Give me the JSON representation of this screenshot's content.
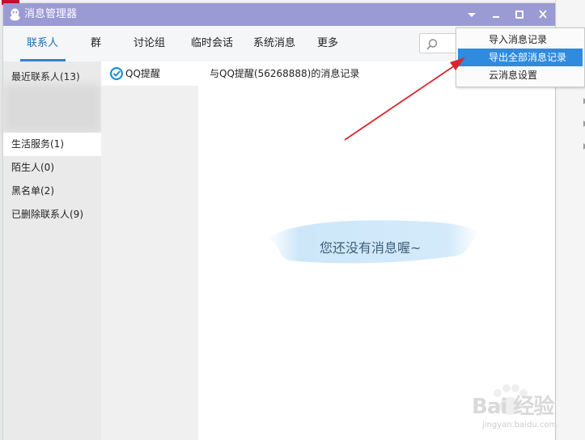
{
  "window": {
    "title": "消息管理器"
  },
  "tabs": [
    {
      "label": "联系人",
      "active": true
    },
    {
      "label": "群",
      "active": false
    },
    {
      "label": "讨论组",
      "active": false
    },
    {
      "label": "临时会话",
      "active": false
    },
    {
      "label": "系统消息",
      "active": false
    },
    {
      "label": "更多",
      "active": false
    }
  ],
  "sidebar": {
    "items": [
      {
        "label": "最近联系人(13)"
      },
      {
        "label": "生活服务(1)",
        "selected": true
      },
      {
        "label": "陌生人(0)"
      },
      {
        "label": "黑名单(2)"
      },
      {
        "label": "已删除联系人(9)"
      }
    ]
  },
  "contact_list": {
    "items": [
      {
        "label": "QQ提醒"
      }
    ]
  },
  "message_area": {
    "header": "与QQ提醒(56268888)的消息记录",
    "empty_text": "您还没有消息喔~"
  },
  "dropdown_menu": {
    "items": [
      {
        "label": "导入消息记录"
      },
      {
        "label": "导出全部消息记录",
        "highlighted": true
      },
      {
        "label": "云消息设置"
      }
    ]
  },
  "watermark": {
    "brand": "Bai 经验",
    "url": "jingyan.baidu.com"
  },
  "colors": {
    "titlebar": "#9a9ad4",
    "tab_active": "#1a6fb5",
    "menu_highlight": "#2f8be0",
    "arrow": "#d9262e"
  },
  "icons": [
    "qq-penguin-icon",
    "dropdown-triangle-icon",
    "minimize-icon",
    "maximize-icon",
    "close-icon",
    "search-icon",
    "qq-reminder-icon"
  ]
}
